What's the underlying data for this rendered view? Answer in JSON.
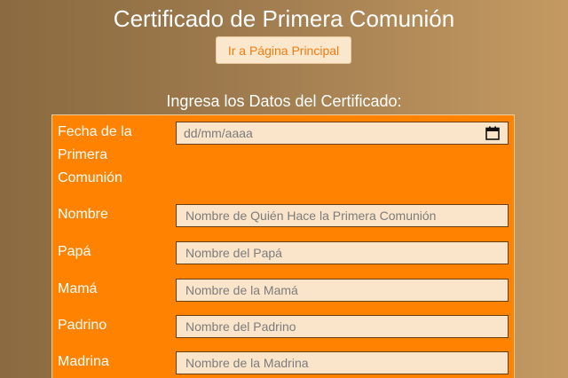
{
  "page": {
    "title": "Certificado de Primera Comunión",
    "home_button": "Ir a Página Principal",
    "section_title": "Ingresa los Datos del Certificado:"
  },
  "form": {
    "fields": [
      {
        "id": "fecha",
        "label": "Fecha de la Primera Comunión",
        "type": "date",
        "placeholder": "dd/mm/aaaa",
        "icon": "calendar-icon"
      },
      {
        "id": "nombre",
        "label": "Nombre",
        "type": "text",
        "placeholder": "Nombre de Quién Hace la Primera Comunión"
      },
      {
        "id": "papa",
        "label": "Papá",
        "type": "text",
        "placeholder": "Nombre del Papá"
      },
      {
        "id": "mama",
        "label": "Mamá",
        "type": "text",
        "placeholder": "Nombre de la Mamá"
      },
      {
        "id": "padrino",
        "label": "Padrino",
        "type": "text",
        "placeholder": "Nombre del Padrino"
      },
      {
        "id": "madrina",
        "label": "Madrina",
        "type": "text",
        "placeholder": "Nombre de la Madrina"
      }
    ]
  },
  "colors": {
    "panel": "#ff8200",
    "input_bg": "#fae5cb",
    "button_text": "#f07d10"
  }
}
